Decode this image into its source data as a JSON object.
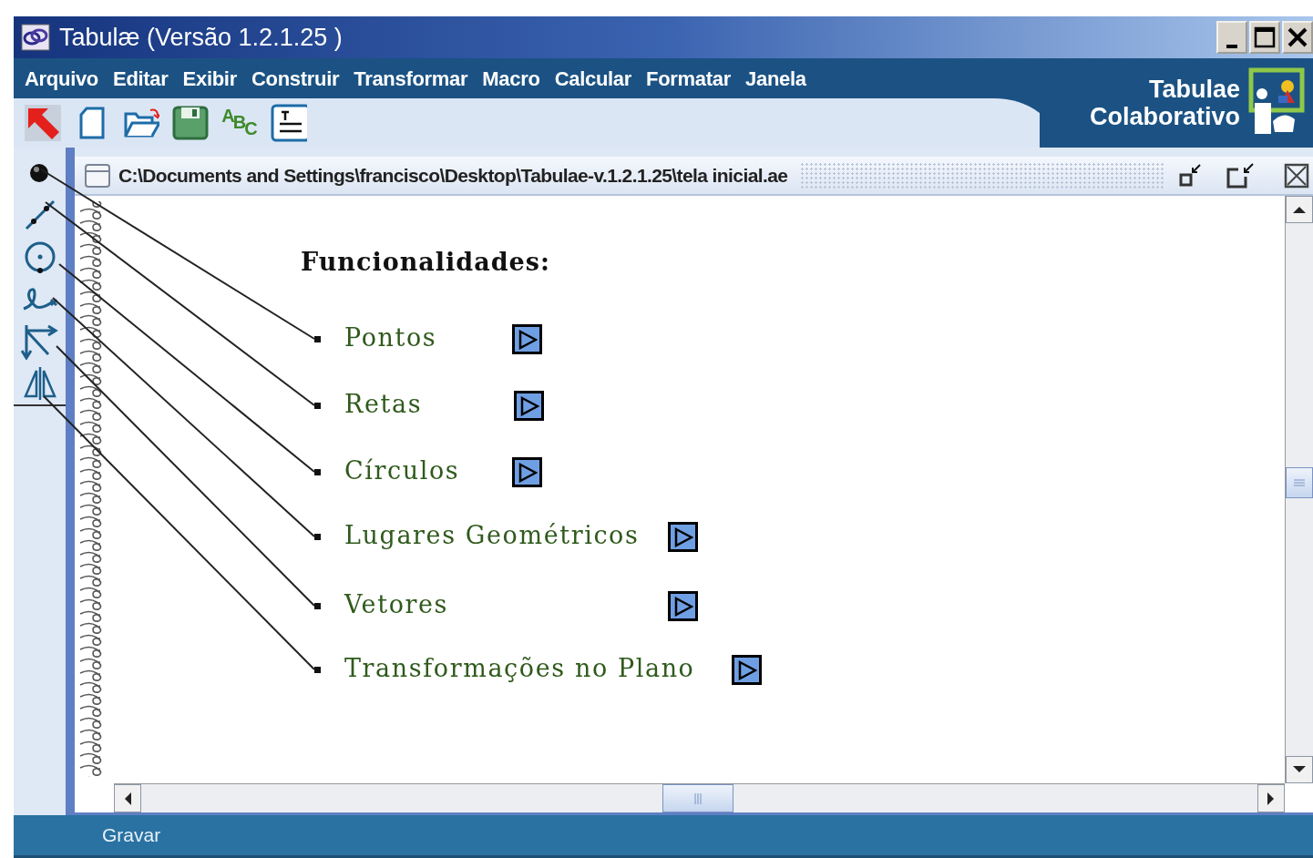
{
  "window": {
    "title": "Tabulæ (Versão 1.2.1.25 )"
  },
  "menu": [
    {
      "label": "Arquivo"
    },
    {
      "label": "Editar"
    },
    {
      "label": "Exibir"
    },
    {
      "label": "Construir"
    },
    {
      "label": "Transformar"
    },
    {
      "label": "Macro"
    },
    {
      "label": "Calcular"
    },
    {
      "label": "Formatar"
    },
    {
      "label": "Janela"
    }
  ],
  "toolbar": [
    {
      "kind": "pointer"
    },
    {
      "kind": "new"
    },
    {
      "kind": "open"
    },
    {
      "kind": "save"
    },
    {
      "kind": "text",
      "glyph": "ABC"
    },
    {
      "kind": "label"
    }
  ],
  "logo": {
    "lines": [
      "Tabulae",
      "Colaborativo"
    ]
  },
  "document": {
    "title": "C:\\Documents and Settings\\francisco\\Desktop\\Tabulae-v.1.2.1.25\\tela inicial.ae",
    "heading": "Funcionalidades:",
    "topics": [
      {
        "label": "Pontos"
      },
      {
        "label": "Retas"
      },
      {
        "label": "Círculos"
      },
      {
        "label": "Lugares Geométricos"
      },
      {
        "label": "Vetores"
      },
      {
        "label": "Transformações no Plano"
      }
    ]
  },
  "status_bar": {
    "text": "Gravar"
  }
}
